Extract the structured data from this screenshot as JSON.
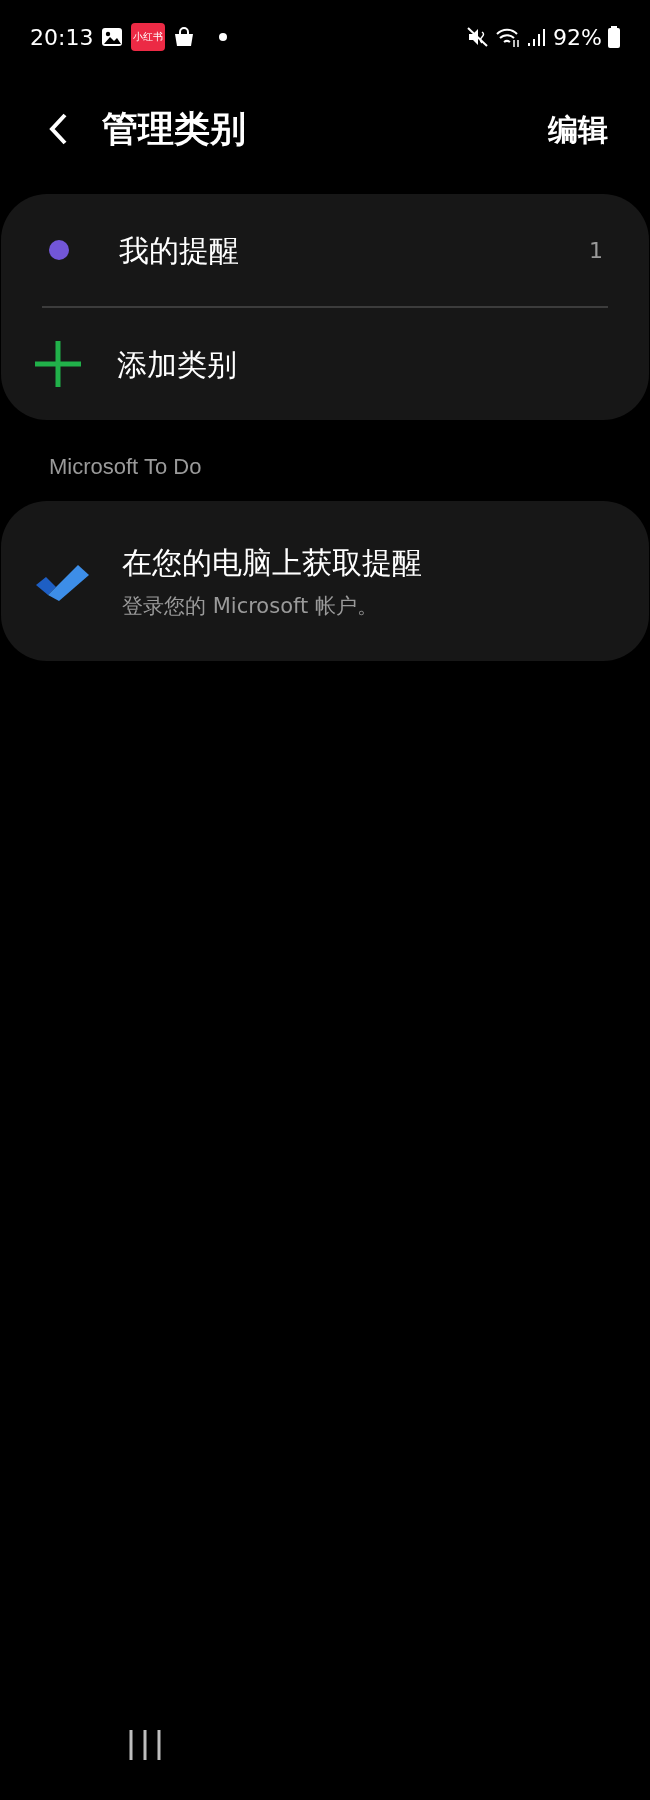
{
  "status_bar": {
    "time": "20:13",
    "app_badge": "小红书",
    "battery": "92%"
  },
  "header": {
    "title": "管理类别",
    "action": "编辑"
  },
  "categories": [
    {
      "kind": "category",
      "label": "我的提醒",
      "count": "1",
      "color": "#7256d8"
    },
    {
      "kind": "add",
      "label": "添加类别"
    }
  ],
  "section": {
    "title": "Microsoft To Do",
    "item": {
      "title": "在您的电脑上获取提醒",
      "subtitle": "登录您的 Microsoft 帐户。"
    }
  }
}
